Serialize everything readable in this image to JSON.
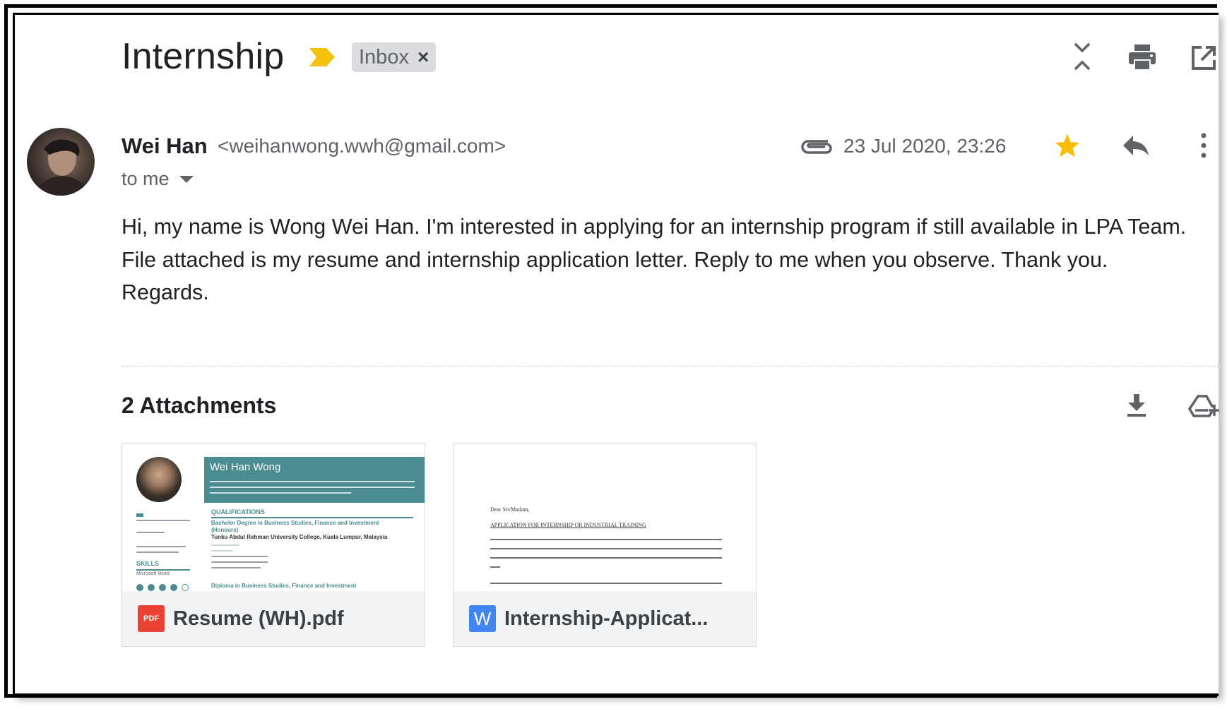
{
  "header": {
    "subject": "Internship",
    "label": "Inbox",
    "label_remove": "×"
  },
  "toolbar": {
    "icons": [
      "collapse-all-icon",
      "print-icon",
      "open-in-new-window-icon"
    ]
  },
  "message": {
    "sender_name": "Wei Han",
    "sender_email": "<weihanwong.wwh@gmail.com>",
    "recipient": "to me",
    "date": "23 Jul 2020, 23:26",
    "starred": true,
    "body_lines": [
      "Hi, my name is Wong Wei Han. I'm interested in applying for an internship program if still available in LPA Team.",
      "File attached is my resume and internship application letter. Reply to me when you observe. Thank you.",
      "Regards."
    ]
  },
  "attachments": {
    "title": "2 Attachments",
    "items": [
      {
        "name": "Resume (WH).pdf",
        "type_badge": "PDF",
        "accent": "#ea4335",
        "preview": {
          "name": "Wei Han Wong",
          "section_qualifications": "QUALIFICATIONS",
          "degree": "Bachelor Degree in Business Studies, Finance and Investment",
          "honours": "(Honours)",
          "institution": "Tunku Abdul Rahman University College, Kuala Lumpur, Malaysia",
          "section_skills": "SKILLS",
          "skill": "Microsoft Word",
          "diploma": "Diploma in Business Studies, Finance and Investment"
        }
      },
      {
        "name": "Internship-Applicat...",
        "type_badge": "W",
        "accent": "#4285f4",
        "preview": {
          "salutation": "Dear Sir/Madam,",
          "heading": "APPLICATION FOR INTERNSHIP OR INDUSTRIAL TRAINING"
        }
      }
    ]
  },
  "colors": {
    "star": "#fbbc04",
    "importance_marker": "#f4c20d",
    "resume_header": "#4b8c91",
    "pdf_red": "#ea4335",
    "word_blue": "#4285f4"
  }
}
